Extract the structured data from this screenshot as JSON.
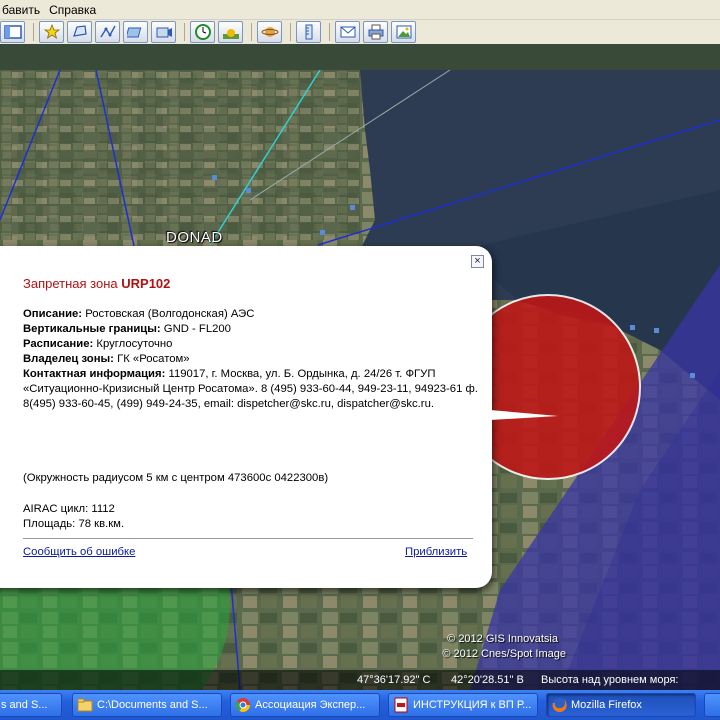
{
  "menu": {
    "items": [
      "бавить",
      "Справка"
    ]
  },
  "map": {
    "place_label": "DONAD",
    "attribution_1": "© 2012 GIS Innovatsia",
    "attribution_2": "© 2012 Cnes/Spot Image",
    "coord_lat": "47°36'17.92\" С",
    "coord_lon": "42°20'28.51\" В",
    "altitude_label": "Высота над уровнем моря:"
  },
  "popup": {
    "title_prefix": "Запретная зона",
    "title_code": "URP102",
    "rows": [
      {
        "label": "Описание:",
        "value": " Ростовская (Волгодонская) АЭС"
      },
      {
        "label": "Вертикальные границы:",
        "value": " GND - FL200"
      },
      {
        "label": "Расписание:",
        "value": " Круглосуточно"
      },
      {
        "label": "Владелец зоны:",
        "value": " ГК «Росатом»"
      },
      {
        "label": "Контактная информация:",
        "value": " 119017, г. Москва, ул. Б. Ордынка, д. 24/26 т. ФГУП «Ситуационно-Кризисный Центр Росатома». 8 (495) 933-60-44, 949-23-11, 94923-61 ф. 8(495) 933-60-45, (499) 949-24-35, email: dispetcher@skc.ru, dispatcher@skc.ru."
      }
    ],
    "circle_note": "(Окружность радиусом 5 км с центром 473600с 0422300в)",
    "airac": "AIRAC цикл: 1112",
    "area": "Площадь: 78 кв.км.",
    "report_link": "Сообщить об ошибке",
    "zoom_link": "Приблизить",
    "close_label": "×"
  },
  "taskbar": {
    "items": [
      {
        "label": "s and S...",
        "icon": "app-icon"
      },
      {
        "label": "C:\\Documents and S...",
        "icon": "folder-icon"
      },
      {
        "label": "Ассоциация Экспер...",
        "icon": "chrome-icon"
      },
      {
        "label": "ИНСТРУКЦИЯ к ВП Р...",
        "icon": "pdf-icon"
      },
      {
        "label": "Mozilla Firefox",
        "icon": "firefox-icon"
      }
    ]
  }
}
